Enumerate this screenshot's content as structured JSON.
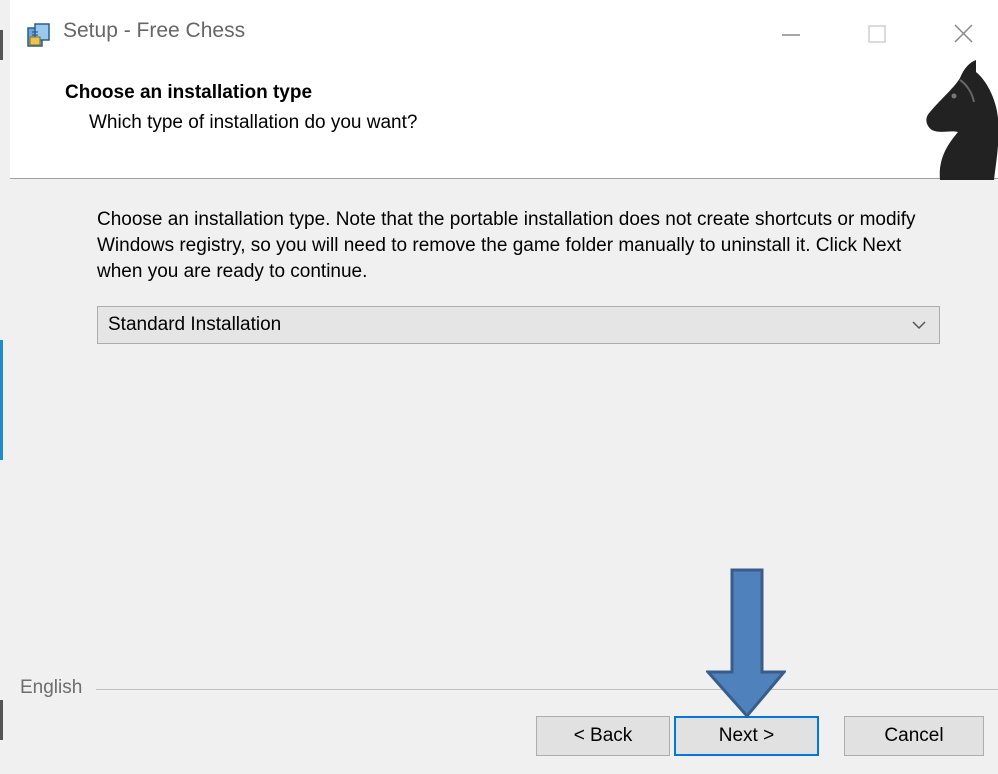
{
  "window": {
    "title": "Setup - Free Chess",
    "icon": "setup-installer-icon",
    "controls": [
      "minimize-icon",
      "maximize-icon",
      "close-icon"
    ]
  },
  "header": {
    "title": "Choose an installation type",
    "subtitle": "Which type of installation do you want?",
    "logo": "chess-knight-icon"
  },
  "main": {
    "description": "Choose an installation type. Note that the portable installation does not create shortcuts or modify Windows registry, so you will need to remove the game folder manually to uninstall it. Click Next when you are ready to continue.",
    "install_type": {
      "selected": "Standard Installation"
    }
  },
  "footer": {
    "language": "English",
    "back_label": "< Back",
    "next_label": "Next >",
    "cancel_label": "Cancel"
  },
  "annotation": {
    "icon": "down-arrow-icon",
    "color": "#4f81bd"
  }
}
